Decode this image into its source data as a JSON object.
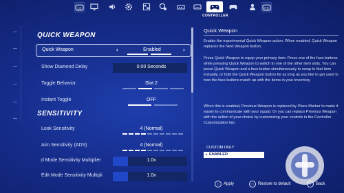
{
  "top_nav": {
    "active_tab_label": "CONTROLLER",
    "tabs": [
      {
        "icon": "lb-bumper-icon"
      },
      {
        "icon": "monitor-icon"
      },
      {
        "icon": "speaker-icon"
      },
      {
        "icon": "gear-icon"
      },
      {
        "icon": "image-grid-icon"
      },
      {
        "icon": "accessibility-icon"
      },
      {
        "icon": "touch-icon"
      },
      {
        "icon": "keyboard-icon"
      },
      {
        "icon": "controller-icon"
      },
      {
        "icon": "gamepad-icon"
      },
      {
        "icon": "person-icon"
      },
      {
        "icon": "rb-bumper-icon"
      }
    ]
  },
  "sections": {
    "quick_weapon": "QUICK WEAPON",
    "sensitivity": "SENSITIVITY"
  },
  "settings": [
    {
      "label": "Quick Weapon",
      "value": "Enabled",
      "selected": true
    },
    {
      "label": "Show Diamond Delay",
      "value": "0.00 Seconds",
      "fill": 0.0
    },
    {
      "label": "Toggle Behavior",
      "value": "Slot 2",
      "level": 2,
      "of": 4
    },
    {
      "label": "Instant Toggle",
      "value": "OFF",
      "level": 1,
      "of": 2
    },
    {
      "label": "Look Sensitivity",
      "value": "4 (Normal)",
      "level": 4,
      "of": 10
    },
    {
      "label": "Aim Sensitivity (ADS)",
      "value": "4 (Normal)",
      "level": 4,
      "of": 10
    },
    {
      "label": ":d Mode Sensitivity Multiplier",
      "value": "1.0x",
      "fill": 0.2
    },
    {
      "label": "Edit Mode Sensitivity Multipli",
      "value": "1.0x",
      "fill": 0.2
    }
  ],
  "info": {
    "title": "Quick Weapon",
    "paragraphs": [
      "Enable the experimental Quick Weapon action. When enabled, Quick Weapon replaces the Next Weapon button.",
      "Press Quick Weapon to equip your primary item. Press one of the face buttons while pressing Quick Weapon to switch to one of the other item slots. You can press Quick Weapon and a face button simultaneously to swap to that item instantly, or hold the Quick Weapon button for as long as you like to get used to how the face buttons match up with the items in your inventory.",
      "When this is enabled, Previous Weapon is replaced by Place Marker to make it easier to communicate with your squad. Or you can replace Previous Weapon with the action of your choice by customizing your controls in the Controller Customization tab."
    ],
    "option_custom": "CUSTOM ONLY",
    "option_enabled": "ENABLED"
  },
  "hints": {
    "apply": "Apply",
    "restore": "Restore to default",
    "back": "Back"
  }
}
